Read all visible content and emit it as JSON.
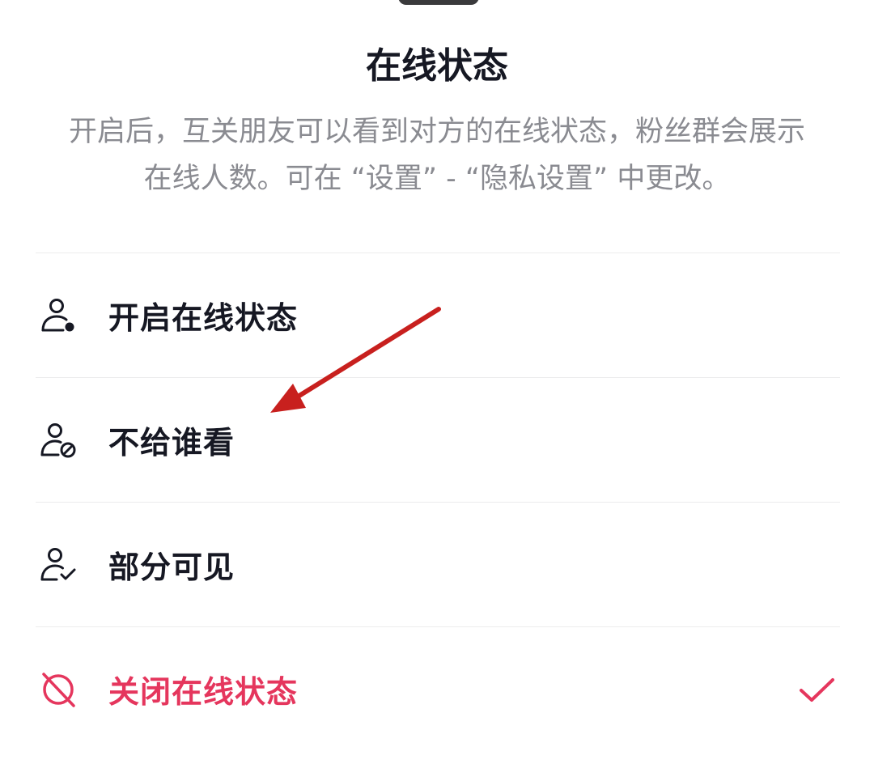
{
  "sheet": {
    "title": "在线状态",
    "description_line1": "开启后，互关朋友可以看到对方的在线状态，粉丝群会展示",
    "description_line2": "在线人数。可在 “设置” - “隐私设置” 中更改。"
  },
  "options": [
    {
      "label": "开启在线状态",
      "icon": "user-online-icon",
      "selected": false
    },
    {
      "label": "不给谁看",
      "icon": "user-blocked-icon",
      "selected": false
    },
    {
      "label": "部分可见",
      "icon": "user-check-icon",
      "selected": false
    },
    {
      "label": "关闭在线状态",
      "icon": "offline-icon",
      "selected": true
    }
  ],
  "colors": {
    "text": "#161823",
    "secondary_text": "#8a8b91",
    "accent": "#e5365d",
    "annotation_arrow": "#c8201e"
  }
}
